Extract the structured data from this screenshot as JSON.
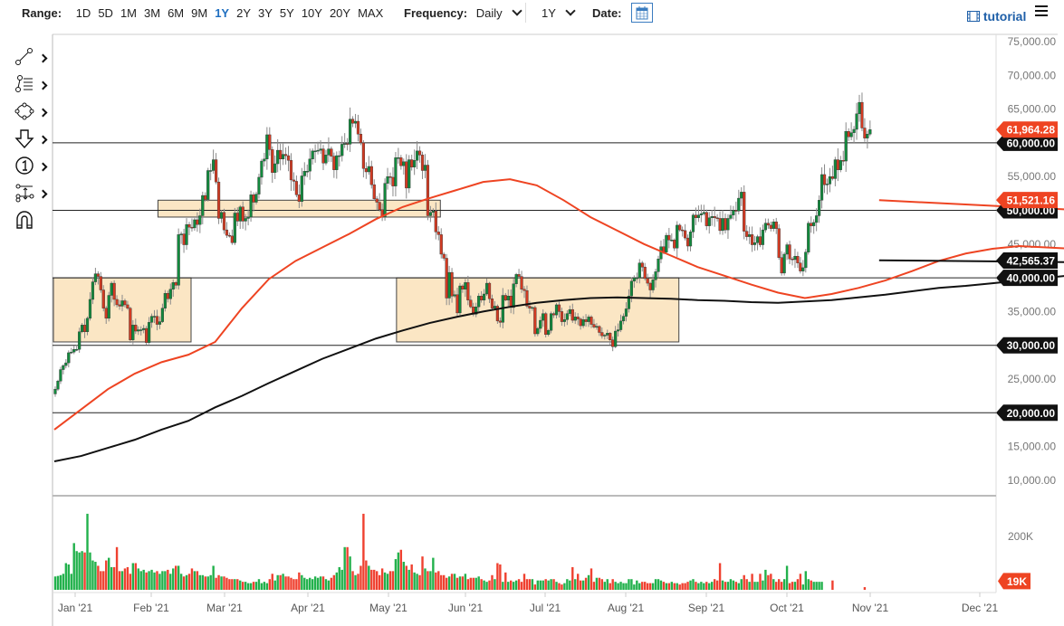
{
  "toolbar": {
    "range_label": "Range:",
    "ranges": [
      "1D",
      "5D",
      "1M",
      "3M",
      "6M",
      "9M",
      "1Y",
      "2Y",
      "3Y",
      "5Y",
      "10Y",
      "20Y",
      "MAX"
    ],
    "active_range": "1Y",
    "frequency_label": "Frequency:",
    "frequency_value": "Daily",
    "period_value": "1Y",
    "date_label": "Date:",
    "tutorial_label": "tutorial"
  },
  "tools": [
    "line-tool",
    "fib-tool",
    "shape-tool",
    "arrow-tool",
    "number-marker-tool",
    "measure-tool",
    "magnet-tool"
  ],
  "colors": {
    "up": "#12893d",
    "down": "#d13a22",
    "ma50": "#ee4422",
    "ma200": "#111111",
    "box_fill": "#fbe6c4",
    "box_stroke": "#444444",
    "vol_up": "#22b14c",
    "vol_down": "#ef4130"
  },
  "chart_data": {
    "type": "candlestick",
    "ylim": [
      10000,
      75000
    ],
    "y_ticks": [
      "75,000.00",
      "70,000.00",
      "65,000.00",
      "60,000.00",
      "55,000.00",
      "50,000.00",
      "45,000.00",
      "40,000.00",
      "35,000.00",
      "30,000.00",
      "25,000.00",
      "20,000.00",
      "15,000.00",
      "10,000.00"
    ],
    "y_tick_values": [
      75000,
      70000,
      65000,
      60000,
      55000,
      50000,
      45000,
      40000,
      35000,
      30000,
      25000,
      20000,
      15000,
      10000
    ],
    "x_ticks": [
      "Jan '21",
      "Feb '21",
      "Mar '21",
      "Apr '21",
      "May '21",
      "Jun '21",
      "Jul '21",
      "Aug '21",
      "Sep '21",
      "Oct '21",
      "Nov '21",
      "Dec '21"
    ],
    "horizontal_lines": [
      {
        "value": 60000,
        "label": "60,000.00"
      },
      {
        "value": 50000,
        "label": "50,000.00"
      },
      {
        "value": 40000,
        "label": "40,000.00"
      },
      {
        "value": 30000,
        "label": "30,000.00"
      },
      {
        "value": 20000,
        "label": "20,000.00"
      }
    ],
    "badges": [
      {
        "label": "61,964.28",
        "value": 61964.28,
        "color": "#ee4422"
      },
      {
        "label": "51,521.16",
        "value": 51521.16,
        "color": "#ee4422"
      },
      {
        "label": "42,565.37",
        "value": 42565.37,
        "color": "#111111"
      }
    ],
    "boxes": [
      {
        "from_index": 0,
        "to_index": 50,
        "low": 30500,
        "high": 40000
      },
      {
        "from_index": 39,
        "to_index": 143,
        "low": 49000,
        "high": 51500
      },
      {
        "from_index": 128,
        "to_index": 232,
        "low": 30500,
        "high": 40000
      }
    ],
    "close_k": [
      23.5,
      24.7,
      26.4,
      27.0,
      27.4,
      28.9,
      29.0,
      29.4,
      29.4,
      32.0,
      33.0,
      32.0,
      34.0,
      36.8,
      39.4,
      40.6,
      40.2,
      38.2,
      35.5,
      34.0,
      37.4,
      39.2,
      36.8,
      36.0,
      35.8,
      36.6,
      36.0,
      35.5,
      30.8,
      33.0,
      32.1,
      32.3,
      32.3,
      32.5,
      30.4,
      33.4,
      34.3,
      34.3,
      33.1,
      33.5,
      35.5,
      37.7,
      36.9,
      38.3,
      39.3,
      38.9,
      46.4,
      46.5,
      44.9,
      47.9,
      47.5,
      47.4,
      48.6,
      47.9,
      49.2,
      52.2,
      51.6,
      55.9,
      55.9,
      57.5,
      54.2,
      48.8,
      49.7,
      47.1,
      46.3,
      46.2,
      45.2,
      49.6,
      48.4,
      50.5,
      48.4,
      48.8,
      49.0,
      52.3,
      51.2,
      52.4,
      54.9,
      57.3,
      57.6,
      61.2,
      59.0,
      55.6,
      56.9,
      58.9,
      57.6,
      58.3,
      58.1,
      57.4,
      54.5,
      54.3,
      52.3,
      51.3,
      55.1,
      55.8,
      55.8,
      57.6,
      58.8,
      58.8,
      58.9,
      59.1,
      57.0,
      58.2,
      59.1,
      58.0,
      56.0,
      58.1,
      58.1,
      59.8,
      59.9,
      59.8,
      63.5,
      62.9,
      63.2,
      61.3,
      60.0,
      56.2,
      55.7,
      56.5,
      53.8,
      51.7,
      51.2,
      50.1,
      49.0,
      54.0,
      55.0,
      54.9,
      53.6,
      57.8,
      57.8,
      56.6,
      57.2,
      53.3,
      57.5,
      56.4,
      57.4,
      58.8,
      58.2,
      55.9,
      56.7,
      49.2,
      49.7,
      49.9,
      46.8,
      46.4,
      43.5,
      42.9,
      37.0,
      40.8,
      37.3,
      37.5,
      34.8,
      38.8,
      38.3,
      39.3,
      36.7,
      35.7,
      34.6,
      35.7,
      37.3,
      36.7,
      37.6,
      39.2,
      36.9,
      35.5,
      35.8,
      33.6,
      33.4,
      37.4,
      36.7,
      37.3,
      35.6,
      39.1,
      40.5,
      40.2,
      38.3,
      38.1,
      35.8,
      35.5,
      35.6,
      31.7,
      32.5,
      33.7,
      34.7,
      31.6,
      32.2,
      34.7,
      34.5,
      36.0,
      35.0,
      33.5,
      33.8,
      34.7,
      35.3,
      33.7,
      34.2,
      33.9,
      32.9,
      33.8,
      33.5,
      34.2,
      33.1,
      32.7,
      32.8,
      31.9,
      31.4,
      31.5,
      31.8,
      30.8,
      29.8,
      32.1,
      32.3,
      33.6,
      34.3,
      35.4,
      37.3,
      39.5,
      40.0,
      40.0,
      42.2,
      41.6,
      39.9,
      39.2,
      38.2,
      39.7,
      40.9,
      42.8,
      44.6,
      43.8,
      46.3,
      45.6,
      45.6,
      44.4,
      47.8,
      47.1,
      47.0,
      45.9,
      44.7,
      46.8,
      49.3,
      48.9,
      49.3,
      49.5,
      49.7,
      47.7,
      48.9,
      49.1,
      48.9,
      48.8,
      47.0,
      48.8,
      47.1,
      48.8,
      49.3,
      50.0,
      49.9,
      51.8,
      52.7,
      46.9,
      46.1,
      46.4,
      44.9,
      45.2,
      46.1,
      44.9,
      47.1,
      48.1,
      47.8,
      47.3,
      48.3,
      47.3,
      43.0,
      40.7,
      43.5,
      44.9,
      42.8,
      42.7,
      43.2,
      42.2,
      41.0,
      41.5,
      43.8,
      48.1,
      47.7,
      48.2,
      49.2,
      51.5,
      55.3,
      53.8,
      53.9,
      55.0,
      54.7,
      57.5,
      56.0,
      57.4,
      57.3,
      61.7,
      60.9,
      61.5,
      62.0,
      64.3,
      66.0,
      62.2,
      60.7,
      61.3,
      61.96
    ],
    "ma50_k_every10": [
      17.5,
      20.5,
      23.5,
      25.8,
      27.5,
      28.6,
      30.5,
      35.5,
      39.8,
      42.5,
      44.5,
      46.5,
      48.7,
      50.5,
      51.8,
      53.0,
      54.2,
      54.6,
      53.7,
      51.5,
      49.0,
      47.0,
      45.0,
      43.3,
      41.6,
      40.3,
      39.0,
      37.8,
      37.0,
      37.6,
      38.5,
      39.6,
      41.0,
      42.5,
      43.6,
      44.3,
      44.7,
      44.5,
      44.3,
      45.5,
      47.0,
      49.5,
      51.5
    ],
    "ma200_k_every10": [
      12.8,
      13.6,
      14.8,
      16.0,
      17.5,
      18.8,
      20.8,
      22.5,
      24.4,
      26.2,
      28.0,
      29.5,
      31.0,
      32.2,
      33.3,
      34.2,
      35.0,
      35.7,
      36.3,
      36.7,
      37.0,
      37.1,
      37.0,
      36.9,
      36.7,
      36.6,
      36.4,
      36.3,
      36.5,
      36.7,
      37.1,
      37.5,
      38.0,
      38.5,
      38.8,
      39.2,
      39.6,
      40.0,
      40.4,
      41.0,
      41.7,
      42.2,
      42.6
    ],
    "volume_axis": {
      "tick": "200K",
      "tick_value": 200,
      "last_label": "19K",
      "last_value": 19
    },
    "volume_k": [
      50,
      52,
      55,
      60,
      100,
      95,
      60,
      175,
      145,
      140,
      145,
      140,
      285,
      140,
      110,
      105,
      90,
      70,
      70,
      110,
      120,
      85,
      85,
      160,
      70,
      70,
      80,
      85,
      60,
      100,
      100,
      80,
      70,
      75,
      65,
      70,
      75,
      65,
      70,
      60,
      70,
      70,
      75,
      60,
      80,
      90,
      90,
      60,
      50,
      55,
      60,
      80,
      70,
      70,
      55,
      55,
      50,
      50,
      55,
      90,
      45,
      55,
      50,
      50,
      45,
      40,
      40,
      40,
      40,
      35,
      30,
      30,
      25,
      25,
      30,
      30,
      40,
      25,
      30,
      25,
      40,
      60,
      35,
      55,
      55,
      60,
      50,
      50,
      45,
      40,
      40,
      65,
      55,
      45,
      40,
      45,
      40,
      50,
      45,
      50,
      50,
      40,
      35,
      45,
      55,
      65,
      85,
      75,
      160,
      160,
      125,
      70,
      55,
      60,
      90,
      285,
      110,
      90,
      75,
      75,
      70,
      55,
      80,
      65,
      60,
      70,
      70,
      115,
      140,
      150,
      105,
      90,
      75,
      95,
      65,
      60,
      55,
      125,
      80,
      70,
      70,
      120,
      65,
      70,
      55,
      55,
      45,
      50,
      60,
      60,
      45,
      50,
      50,
      60,
      40,
      45,
      45,
      45,
      50,
      40,
      35,
      30,
      35,
      55,
      40,
      100,
      95,
      30,
      65,
      30,
      35,
      30,
      35,
      40,
      30,
      60,
      40,
      40,
      40,
      20,
      35,
      35,
      35,
      40,
      35,
      40,
      40,
      30,
      25,
      20,
      25,
      40,
      35,
      85,
      40,
      60,
      35,
      35,
      45,
      55,
      80,
      30,
      45,
      45,
      40,
      30,
      40,
      25,
      40,
      30,
      25,
      30,
      25,
      25,
      40,
      40,
      20,
      35,
      25,
      30,
      30,
      25,
      25,
      25,
      40,
      40,
      35,
      30,
      25,
      25,
      30,
      25,
      25,
      20,
      25,
      25,
      30,
      35,
      40,
      30,
      25,
      30,
      25,
      30,
      25,
      30,
      40,
      35,
      100,
      35,
      30,
      30,
      40,
      35,
      30,
      25,
      40,
      55,
      40,
      30,
      60,
      30,
      30,
      60,
      35,
      75,
      55,
      60,
      40,
      30,
      40,
      30,
      40,
      90,
      25,
      30,
      30,
      40,
      60,
      20,
      70,
      40,
      35,
      30,
      30,
      30,
      30,
      0,
      0,
      0,
      35,
      0,
      0,
      0,
      0,
      0,
      0,
      0,
      0,
      0,
      0,
      0,
      10,
      0,
      0
    ]
  }
}
